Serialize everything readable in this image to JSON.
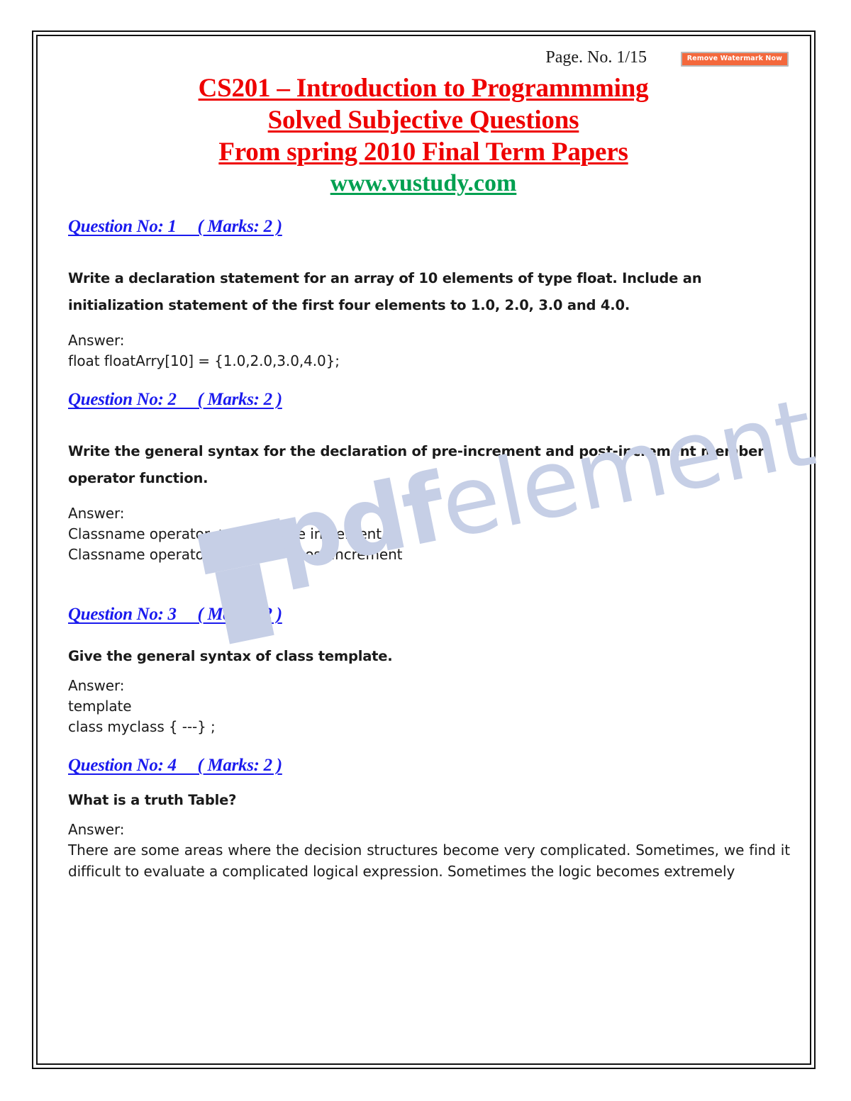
{
  "header": {
    "page_no": "Page. No. 1/15",
    "remove_watermark_label": "Remove Watermark Now"
  },
  "title": {
    "line1": "CS201 – Introduction to Programmming",
    "line2": "Solved Subjective Questions",
    "line3": "From spring 2010 Final Term Papers",
    "url": "www.vustudy.com",
    "color_red": "#ee0000",
    "color_green": "#00a050"
  },
  "watermark": {
    "brand_bold": "pdf",
    "brand_light": "element",
    "color": "#c6cfe6"
  },
  "questions": [
    {
      "heading": "Question No: 1     ( Marks: 2 )",
      "prompt": "Write a declaration statement for an array of 10 elements of type float. Include an initialization statement of the first four elements to 1.0, 2.0, 3.0 and 4.0.",
      "answer_label": "Answer:",
      "answer_lines": [
        "float  floatArry[10] = {1.0,2.0,3.0,4.0};"
      ]
    },
    {
      "heading": "Question No: 2     ( Marks: 2 )",
      "prompt": "Write the general syntax for the declaration of pre-increment and post-increment member operator function.",
      "answer_label": "Answer:",
      "answer_lines": [
        "Classname operator ++();  ---- pre increment",
        "Classname operator ++(int)  ---- post increment"
      ]
    },
    {
      "heading": "Question No: 3     ( Marks: 2 )",
      "prompt": "Give the general syntax of class template.",
      "answer_label": "Answer:",
      "answer_lines": [
        "template",
        "class myclass { ---} ;"
      ]
    },
    {
      "heading": "Question No: 4     ( Marks: 2 )",
      "prompt": "What is a truth Table?",
      "answer_label": "Answer:",
      "answer_paragraph": "There are some areas where the decision structures become very complicated. Sometimes, we find it difficult to evaluate a complicated logical expression. Sometimes the logic becomes extremely"
    }
  ],
  "question_heading_color": "#1a1aee"
}
